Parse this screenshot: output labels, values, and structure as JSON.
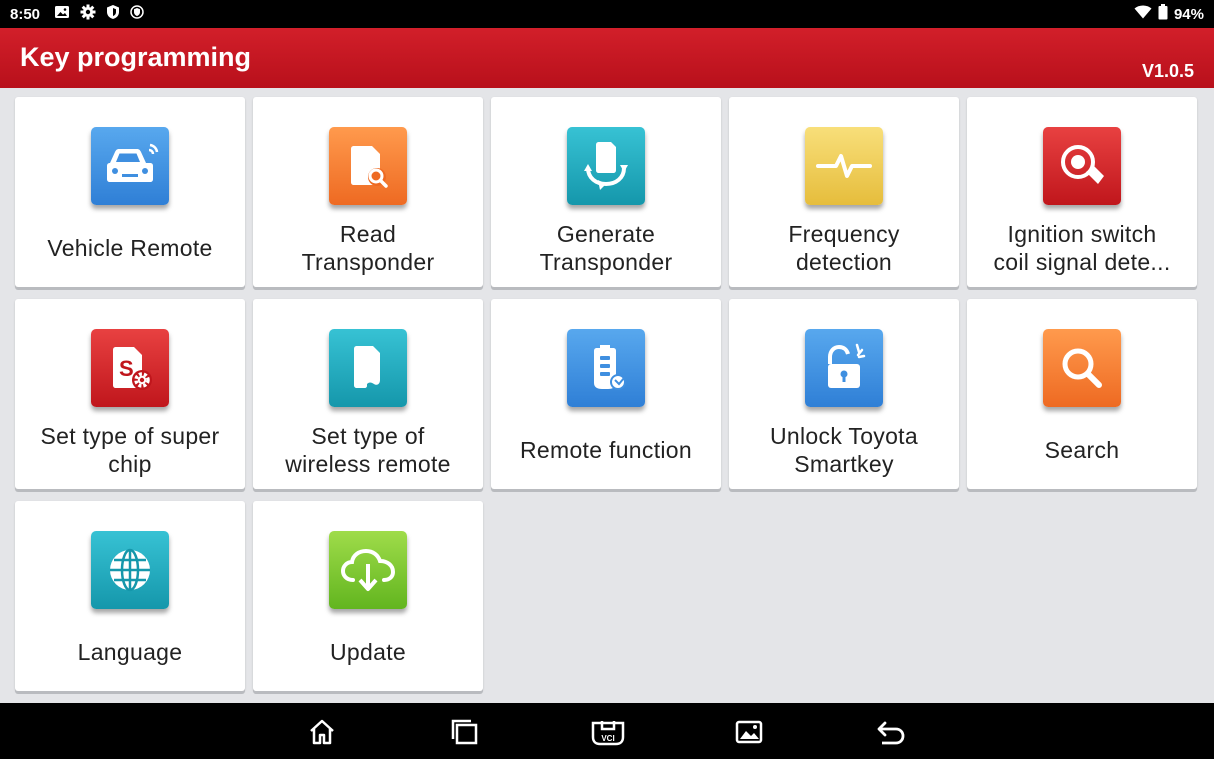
{
  "status_bar": {
    "time": "8:50",
    "battery": "94%",
    "icons": [
      "image-icon",
      "gear-icon",
      "shield-icon",
      "vpn-icon",
      "wifi-icon",
      "battery-icon"
    ]
  },
  "header": {
    "title": "Key programming",
    "version": "V1.0.5",
    "background": "#c5151f"
  },
  "tiles": [
    {
      "label": "Vehicle Remote",
      "icon": "car-remote-icon",
      "color": "blue"
    },
    {
      "label": "Read\nTransponder",
      "icon": "read-chip-icon",
      "color": "orange"
    },
    {
      "label": "Generate\nTransponder",
      "icon": "generate-chip-icon",
      "color": "teal"
    },
    {
      "label": "Frequency\ndetection",
      "icon": "frequency-wave-icon",
      "color": "yellow"
    },
    {
      "label": "Ignition switch\ncoil signal dete...",
      "icon": "ignition-key-icon",
      "color": "red"
    },
    {
      "label": "Set type of super\nchip",
      "icon": "super-chip-settings-icon",
      "color": "red"
    },
    {
      "label": "Set type of\nwireless remote",
      "icon": "wireless-chip-icon",
      "color": "teal"
    },
    {
      "label": "Remote function",
      "icon": "remote-key-icon",
      "color": "blue"
    },
    {
      "label": "Unlock Toyota\nSmartkey",
      "icon": "unlock-icon",
      "color": "blue"
    },
    {
      "label": "Search",
      "icon": "search-icon",
      "color": "orange"
    },
    {
      "label": "Language",
      "icon": "globe-icon",
      "color": "teal"
    },
    {
      "label": "Update",
      "icon": "cloud-download-icon",
      "color": "green"
    }
  ],
  "nav_bar": {
    "buttons": [
      "home-icon",
      "recent-apps-icon",
      "vci-icon",
      "screenshot-icon",
      "back-icon"
    ],
    "vci_label": "VCI"
  }
}
